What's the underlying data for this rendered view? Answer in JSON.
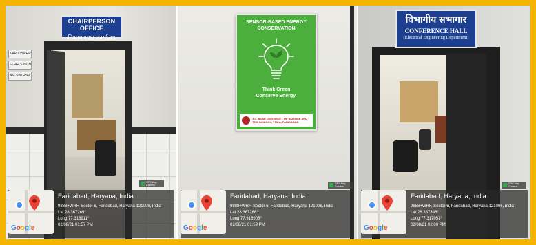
{
  "photos": [
    {
      "sign": {
        "line1": "CHAIRPERSON OFFICE",
        "line2": "विभागाध्यक्ष कार्यालय"
      },
      "plaques": [
        "KAR CHAIRPERSON",
        "EDAR SINGH",
        "AM SINGHAL"
      ],
      "geo": {
        "city": "Faridabad, Haryana, India",
        "address": "9888+WRF, Sector 6, Faridabad, Haryana 121006, India",
        "lat": "Lat 28.367269°",
        "long": "Long 77.316911°",
        "timestamp": "02/08/21 01:57 PM",
        "badge": "GPS Map Camera",
        "google": "Google"
      }
    },
    {
      "board": {
        "title": "SENSOR-BASED ENERGY CONSERVATION",
        "message_line1": "Think Green",
        "message_line2": "Conserve Energy.",
        "footer": "J.C. BOSE UNIVERSITY OF SCIENCE AND TECHNOLOGY, YMCA, FARIDABAD"
      },
      "geo": {
        "city": "Faridabad, Haryana, India",
        "address": "9888+WRF, Sector 6, Faridabad, Haryana 121006, India",
        "lat": "Lat 28.367266°",
        "long": "Long 77.316908°",
        "timestamp": "02/08/21 01:59 PM",
        "badge": "GPS Map Camera",
        "google": "Google"
      }
    },
    {
      "sign": {
        "line1": "विभागीय सभागार",
        "line2": "CONFERENCE HALL",
        "line3": "(Electrical Engineering Department)"
      },
      "geo": {
        "city": "Faridabad, Haryana, India",
        "address": "9888+WRF, Sector 6, Faridabad, Haryana 121006, India",
        "lat": "Lat 28.367346°",
        "long": "Long 77.317051°",
        "timestamp": "02/08/21 02:00 PM",
        "badge": "GPS Map Camera",
        "google": "Google"
      }
    }
  ],
  "colors": {
    "border": "#f4b400",
    "sign_blue": "#1d3f8f",
    "board_green": "#4cae3c",
    "pin_red": "#ea4335"
  }
}
